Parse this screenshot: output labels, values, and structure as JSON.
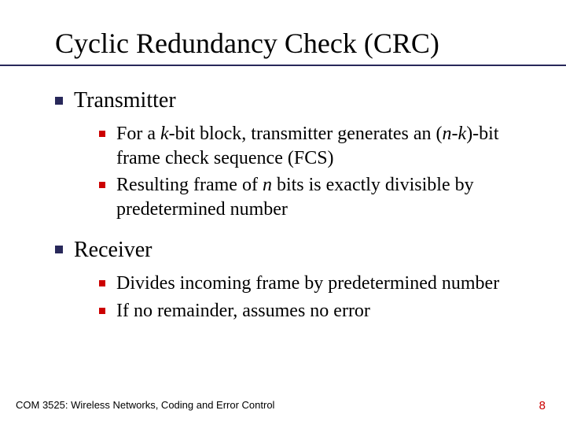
{
  "title": "Cyclic Redundancy Check (CRC)",
  "sections": [
    {
      "heading": "Transmitter",
      "items": [
        {
          "pre": "For a ",
          "em1": "k",
          "mid1": "-bit block, transmitter generates an (",
          "em2": "n-k",
          "post": ")-bit frame check sequence (FCS)"
        },
        {
          "pre": "Resulting frame of ",
          "em1": "n",
          "mid1": " bits is exactly divisible by predetermined number",
          "em2": "",
          "post": ""
        }
      ]
    },
    {
      "heading": "Receiver",
      "items": [
        {
          "pre": "Divides incoming frame by predetermined number",
          "em1": "",
          "mid1": "",
          "em2": "",
          "post": ""
        },
        {
          "pre": "If no remainder, assumes no error",
          "em1": "",
          "mid1": "",
          "em2": "",
          "post": ""
        }
      ]
    }
  ],
  "footer": {
    "left": "COM 3525: Wireless Networks, Coding and Error Control",
    "right": "8"
  }
}
